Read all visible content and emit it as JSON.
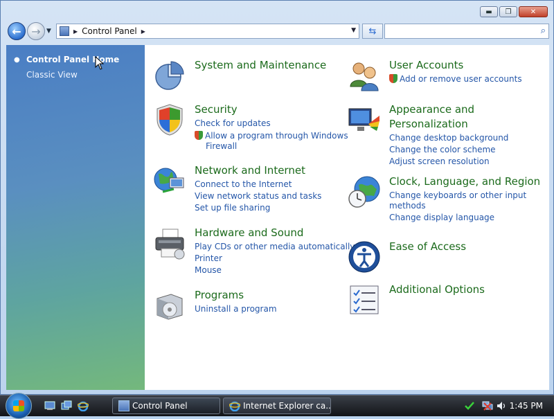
{
  "window": {
    "controls": {
      "minimize": "▬",
      "maximize": "❐",
      "close": "✕"
    }
  },
  "nav": {
    "address": "Control Panel",
    "search_placeholder": ""
  },
  "sidebar": {
    "items": [
      {
        "label": "Control Panel Home"
      },
      {
        "label": "Classic View"
      }
    ]
  },
  "categories": {
    "system": {
      "title": "System and Maintenance",
      "links": []
    },
    "security": {
      "title": "Security",
      "links": [
        "Check for updates",
        "Allow a program through Windows",
        "Firewall"
      ]
    },
    "network": {
      "title": "Network and Internet",
      "links": [
        "Connect to the Internet",
        "View network status and tasks",
        "Set up file sharing"
      ]
    },
    "hardware": {
      "title": "Hardware and Sound",
      "links": [
        "Play CDs or other media automatically",
        "Printer",
        "Mouse"
      ]
    },
    "programs": {
      "title": "Programs",
      "links": [
        "Uninstall a program"
      ]
    },
    "users": {
      "title": "User Accounts",
      "links": [
        "Add or remove user accounts"
      ]
    },
    "appearance": {
      "title_line1": "Appearance and",
      "title_line2": "Personalization",
      "links": [
        "Change desktop background",
        "Change the color scheme",
        "Adjust screen resolution"
      ]
    },
    "clock": {
      "title": "Clock, Language, and Region",
      "links": [
        "Change keyboards or other input",
        "methods",
        "Change display language"
      ]
    },
    "ease": {
      "title": "Ease of Access",
      "links": []
    },
    "additional": {
      "title": "Additional Options",
      "links": []
    }
  },
  "taskbar": {
    "tasks": [
      {
        "label": "Control Panel"
      },
      {
        "label": "Internet Explorer ca..."
      }
    ],
    "clock": "1:45 PM"
  }
}
